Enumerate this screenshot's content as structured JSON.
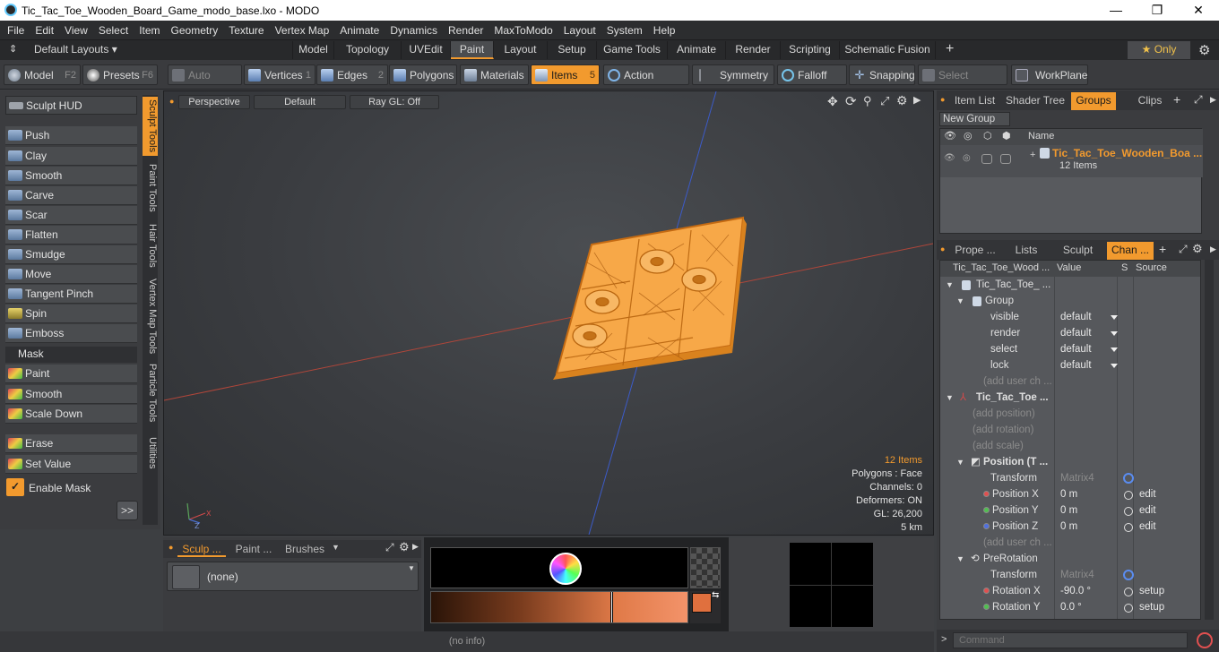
{
  "window": {
    "title": "Tic_Tac_Toe_Wooden_Board_Game_modo_base.lxo - MODO",
    "minimize": "—",
    "maximize": "❐",
    "close": "✕"
  },
  "menu": [
    "File",
    "Edit",
    "View",
    "Select",
    "Item",
    "Geometry",
    "Texture",
    "Vertex Map",
    "Animate",
    "Dynamics",
    "Render",
    "MaxToModo",
    "Layout",
    "System",
    "Help"
  ],
  "layout_row": {
    "default_layouts": "Default Layouts ▾",
    "tabs": [
      "Model",
      "Topology",
      "UVEdit",
      "Paint",
      "Layout",
      "Setup",
      "Game Tools",
      "Animate",
      "Render",
      "Scripting",
      "Schematic Fusion"
    ],
    "active_tab": "Paint",
    "add": "+",
    "only": "★  Only",
    "gear": "⚙"
  },
  "toolbar": {
    "model": "Model",
    "model_key": "F2",
    "presets": "Presets",
    "presets_key": "F6",
    "auto_select": "Auto Select",
    "vertices": "Vertices",
    "vertices_num": "1",
    "edges": "Edges",
    "edges_num": "2",
    "polygons": "Polygons",
    "materials": "Materials",
    "items": "Items",
    "items_num": "5",
    "action_center": "Action Center",
    "symmetry": "Symmetry",
    "falloff": "Falloff",
    "snapping": "Snapping",
    "select_through": "Select Through",
    "workplane": "WorkPlane"
  },
  "sculpt": {
    "hud": "Sculpt HUD",
    "tools": [
      "Push",
      "Clay",
      "Smooth",
      "Carve",
      "Scar",
      "Flatten",
      "Smudge",
      "Move",
      "Tangent Pinch",
      "Spin",
      "Emboss"
    ],
    "mask_header": "Mask",
    "mask_tools": [
      "Paint",
      "Smooth",
      "Scale Down"
    ],
    "extra_tools": [
      "Erase",
      "Set Value"
    ],
    "enable_mask": "Enable Mask",
    "more": ">>",
    "vtabs": [
      "Sculpt Tools",
      "Paint Tools",
      "Hair Tools",
      "Vertex Map Tools",
      "Particle Tools",
      "Utilities"
    ]
  },
  "viewport": {
    "view": "Perspective",
    "style": "Default",
    "render": "Ray GL: Off",
    "info": {
      "items": "12 Items",
      "polygons": "Polygons : Face",
      "channels": "Channels: 0",
      "deformers": "Deformers: ON",
      "gl": "GL: 26,200",
      "scale": "5 km"
    }
  },
  "bottom_left": {
    "tabs": [
      "Sculp ...",
      "Paint ...",
      "Brushes"
    ],
    "brush": "(none)"
  },
  "status": "(no info)",
  "groups_panel": {
    "tabs": [
      "Item List",
      "Shader Tree",
      "Groups",
      "Clips"
    ],
    "active_tab": "Groups",
    "new_group": "New Group",
    "col_name": "Name",
    "group_name": "Tic_Tac_Toe_Wooden_Boa ...",
    "group_count": "12 Items"
  },
  "channels_panel": {
    "tabs": [
      "Prope ...",
      "Lists",
      "Sculpt",
      "Chan ..."
    ],
    "active_tab": "Chan ...",
    "headers": [
      "Tic_Tac_Toe_Wood ...",
      "Value",
      "S",
      "Source"
    ],
    "rows": [
      {
        "label": "Tic_Tac_Toe_ ...",
        "value": "",
        "src": ""
      },
      {
        "label": "Group",
        "value": "",
        "src": ""
      },
      {
        "label": "visible",
        "value": "default",
        "src": ""
      },
      {
        "label": "render",
        "value": "default",
        "src": ""
      },
      {
        "label": "select",
        "value": "default",
        "src": ""
      },
      {
        "label": "lock",
        "value": "default",
        "src": ""
      },
      {
        "label": "(add user ch ...",
        "value": "",
        "src": ""
      },
      {
        "label": "Tic_Tac_Toe ...",
        "value": "",
        "src": ""
      },
      {
        "label": "(add position)",
        "value": "",
        "src": ""
      },
      {
        "label": "(add rotation)",
        "value": "",
        "src": ""
      },
      {
        "label": "(add scale)",
        "value": "",
        "src": ""
      },
      {
        "label": "Position (T ...",
        "value": "",
        "src": ""
      },
      {
        "label": "Transform",
        "value": "Matrix4",
        "src": ""
      },
      {
        "label": "Position X",
        "value": "0 m",
        "src": "edit"
      },
      {
        "label": "Position Y",
        "value": "0 m",
        "src": "edit"
      },
      {
        "label": "Position Z",
        "value": "0 m",
        "src": "edit"
      },
      {
        "label": "(add user ch ...",
        "value": "",
        "src": ""
      },
      {
        "label": "PreRotation",
        "value": "",
        "src": ""
      },
      {
        "label": "Transform",
        "value": "Matrix4",
        "src": ""
      },
      {
        "label": "Rotation X",
        "value": "-90.0 °",
        "src": "setup"
      },
      {
        "label": "Rotation Y",
        "value": "0.0 °",
        "src": "setup"
      }
    ]
  },
  "command": {
    "placeholder": "Command"
  },
  "colors": {
    "accent": "#f29a2e",
    "x_axis": "#c0453a",
    "y_axis": "#3f5fd0",
    "swatch": "#e0703e",
    "fg": "#f5d800"
  }
}
